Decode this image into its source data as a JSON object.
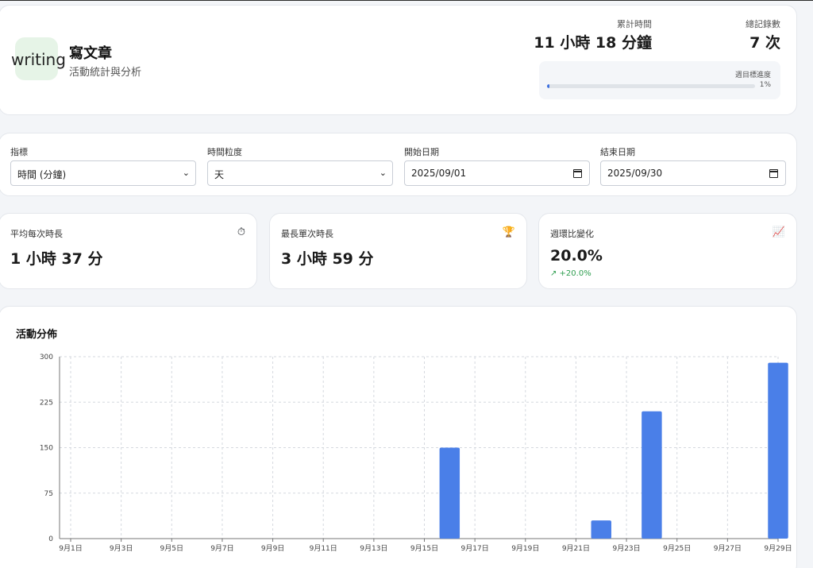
{
  "header": {
    "logo_text": "writing",
    "title": "寫文章",
    "subtitle": "活動統計與分析",
    "total_time_label": "累計時間",
    "total_time_value": "11 小時 18 分鐘",
    "records_label": "總記錄數",
    "records_value": "7 次",
    "weekly_goal_label": "週目標進度",
    "weekly_goal_percent_text": "1%",
    "weekly_goal_fraction": 0.01
  },
  "filters": {
    "metric_label": "指標",
    "metric_value": "時間 (分鐘)",
    "granularity_label": "時間粒度",
    "granularity_value": "天",
    "start_label": "開始日期",
    "start_value": "2025/09/01",
    "end_label": "結束日期",
    "end_value": "2025/09/30"
  },
  "metrics": [
    {
      "label": "平均每次時長",
      "value": "1 小時 37 分",
      "icon": "stopwatch-icon"
    },
    {
      "label": "最長單次時長",
      "value": "3 小時 59 分",
      "icon": "trophy-icon"
    },
    {
      "label": "週環比變化",
      "value": "20.0%",
      "change": "↗ +20.0%",
      "icon": "chart-increasing-icon"
    }
  ],
  "colors": {
    "accent": "#4a7fe8",
    "progress": "#3b6fe0",
    "positive": "#2e9e4f",
    "logo_bg": "#e6f4e7"
  },
  "chart_data": {
    "type": "bar",
    "title": "活動分佈",
    "x": [
      "9月1日",
      "9月2日",
      "9月3日",
      "9月4日",
      "9月5日",
      "9月6日",
      "9月7日",
      "9月8日",
      "9月9日",
      "9月10日",
      "9月11日",
      "9月12日",
      "9月13日",
      "9月14日",
      "9月15日",
      "9月16日",
      "9月17日",
      "9月18日",
      "9月19日",
      "9月20日",
      "9月21日",
      "9月22日",
      "9月23日",
      "9月24日",
      "9月25日",
      "9月26日",
      "9月27日",
      "9月28日",
      "9月29日"
    ],
    "values": [
      0,
      0,
      0,
      0,
      0,
      0,
      0,
      0,
      0,
      0,
      0,
      0,
      0,
      0,
      0,
      150,
      0,
      0,
      0,
      0,
      0,
      30,
      0,
      210,
      0,
      0,
      0,
      0,
      290
    ],
    "tick_labels": [
      "9月1日",
      "9月3日",
      "9月5日",
      "9月7日",
      "9月9日",
      "9月11日",
      "9月13日",
      "9月15日",
      "9月17日",
      "9月19日",
      "9月21日",
      "9月23日",
      "9月25日",
      "9月27日",
      "9月29日"
    ],
    "yticks": [
      0,
      75,
      150,
      225,
      300
    ],
    "ylim": [
      0,
      300
    ],
    "grid": true
  }
}
